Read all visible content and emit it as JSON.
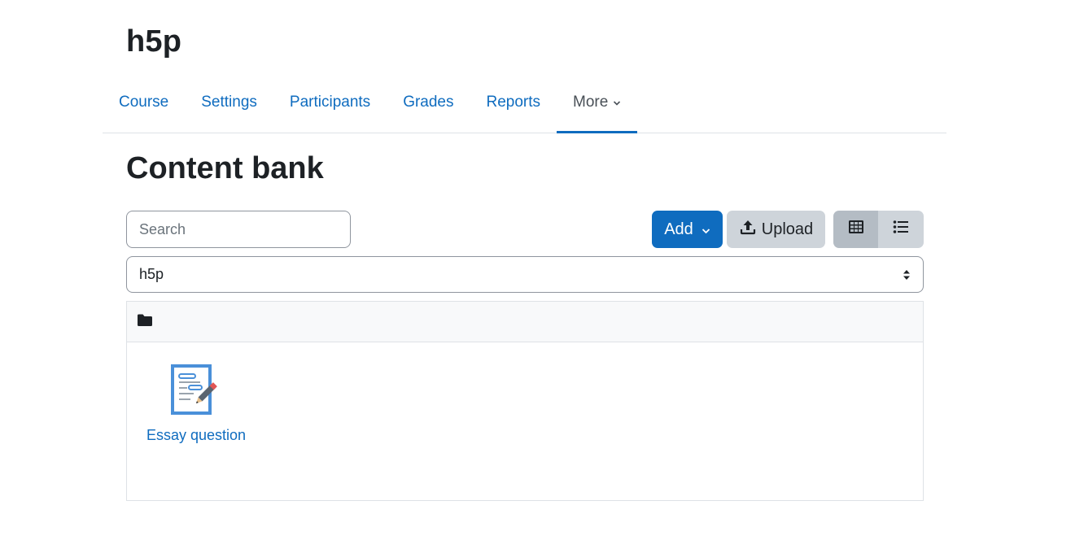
{
  "course": {
    "title": "h5p"
  },
  "nav": {
    "items": [
      {
        "label": "Course"
      },
      {
        "label": "Settings"
      },
      {
        "label": "Participants"
      },
      {
        "label": "Grades"
      },
      {
        "label": "Reports"
      },
      {
        "label": "More",
        "active": true
      }
    ]
  },
  "page": {
    "heading": "Content bank"
  },
  "search": {
    "placeholder": "Search",
    "value": ""
  },
  "toolbar": {
    "add_label": "Add",
    "upload_label": "Upload",
    "grid_view_icon": "grid-icon",
    "list_view_icon": "list-icon"
  },
  "context_select": {
    "selected": "h5p"
  },
  "content": {
    "folder_icon": "folder-icon",
    "items": [
      {
        "name": "Essay question",
        "icon": "essay-question-icon"
      }
    ]
  },
  "colors": {
    "primary": "#0f6cbf",
    "text": "#1d2125",
    "secondary_btn": "#ced4da",
    "active_btn": "#b4bcc4",
    "border": "#dee2e6"
  }
}
